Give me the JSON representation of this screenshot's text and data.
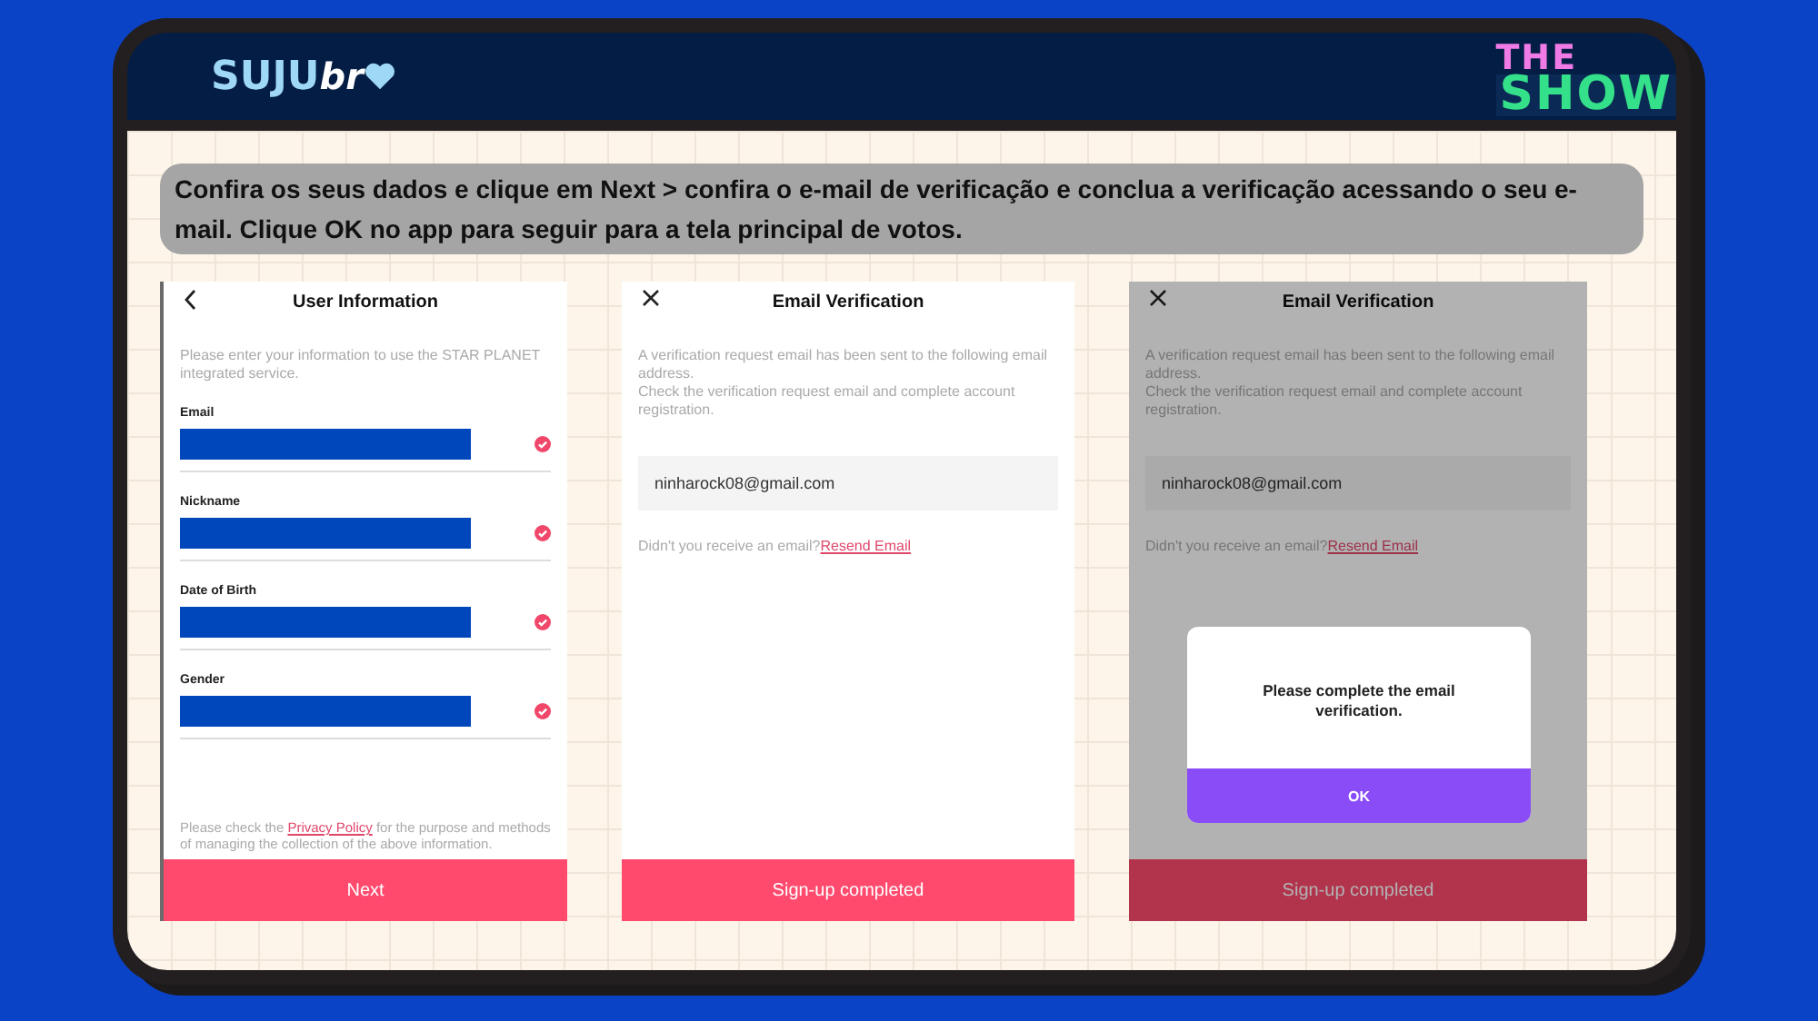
{
  "header": {
    "logo": {
      "main": "SUJU",
      "accent": "br"
    },
    "show_logo": {
      "top": "THE",
      "bottom": "SHOW"
    }
  },
  "instruction": "Confira os seus dados e clique em Next > confira o e-mail de verificação e conclua a verificação acessando o seu e-mail. Clique OK no app para seguir para a tela principal de votos.",
  "screens": [
    {
      "kind": "user_info",
      "title": "User Information",
      "intro": "Please enter your information to use the STAR PLANET integrated service.",
      "fields": [
        {
          "label": "Email",
          "checked": true
        },
        {
          "label": "Nickname",
          "checked": true
        },
        {
          "label": "Date of Birth",
          "checked": true
        },
        {
          "label": "Gender",
          "checked": true
        }
      ],
      "policy_before": "Please check the ",
      "policy_link": "Privacy Policy",
      "policy_after": " for the purpose and methods of managing the collection of the above information.",
      "button": "Next"
    },
    {
      "kind": "email_verification",
      "title": "Email Verification",
      "intro": "A verification request email has been sent to the following email address.",
      "intro2": "Check the verification request email and complete account registration.",
      "email": "ninharock08@gmail.com",
      "resend_prompt": "Didn't you receive an email?",
      "resend_link": "Resend Email",
      "button": "Sign-up completed"
    },
    {
      "kind": "email_verification",
      "title": "Email Verification",
      "intro": "A verification request email has been sent to the following email address.",
      "intro2": "Check the verification request email and complete account registration.",
      "email": "ninharock08@gmail.com",
      "resend_prompt": "Didn't you receive an email?",
      "resend_link": "Resend Email",
      "button": "Sign-up completed",
      "dialog": {
        "message": "Please complete the email verification.",
        "button": "OK"
      }
    }
  ]
}
